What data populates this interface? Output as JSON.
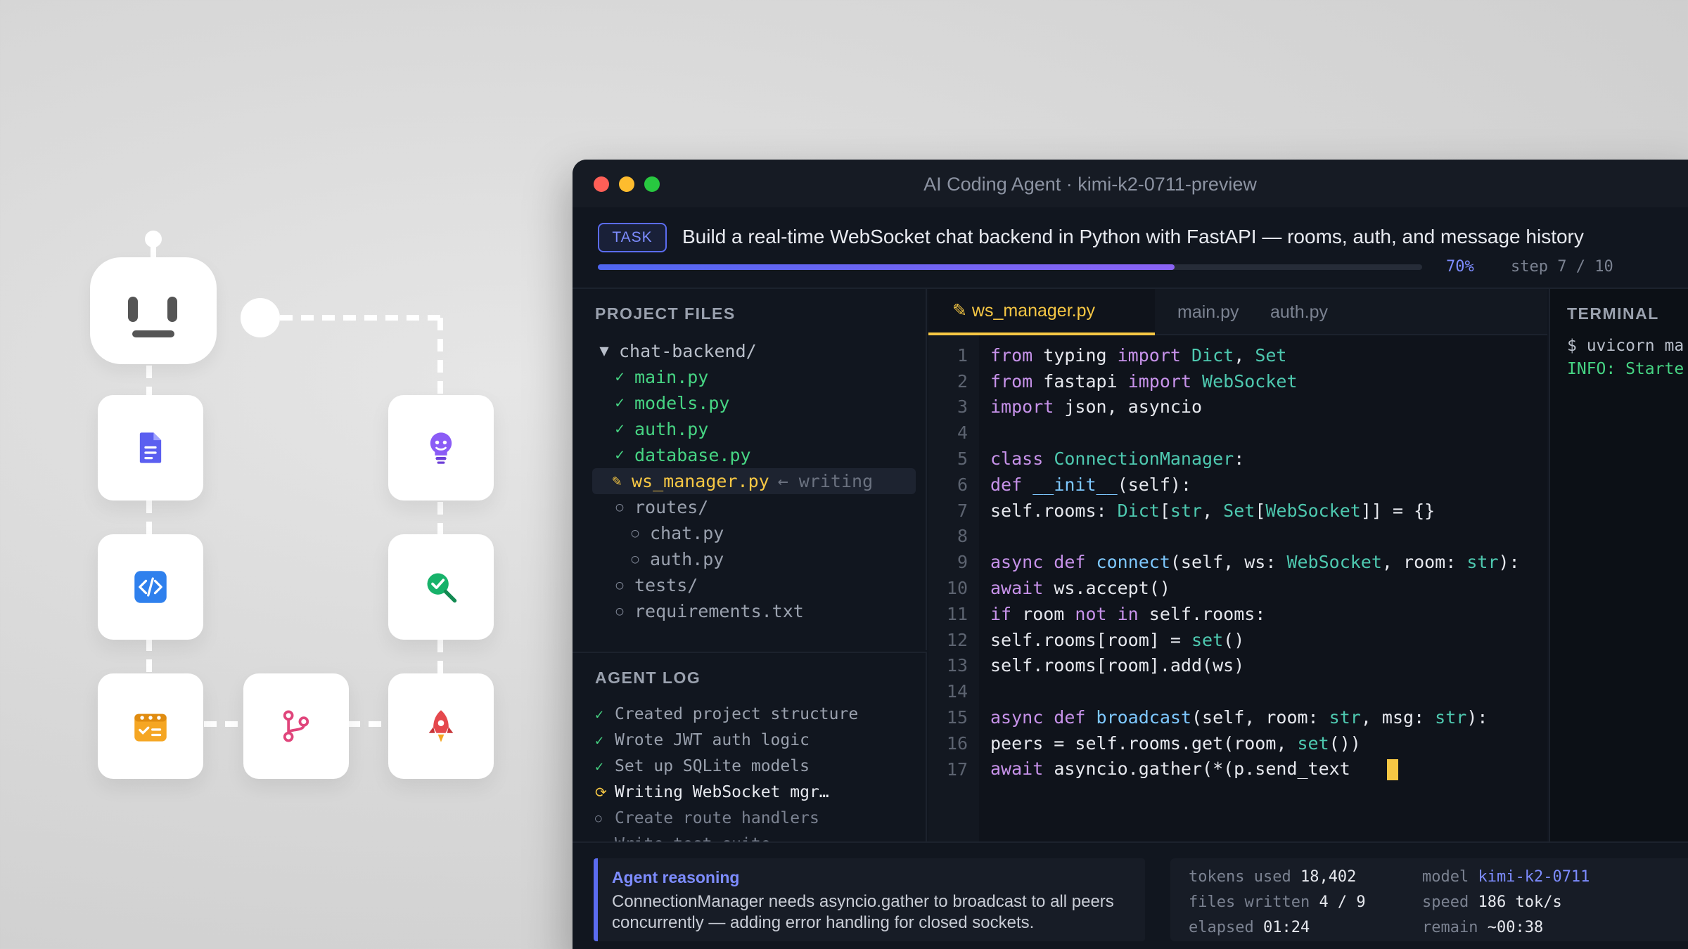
{
  "window": {
    "title": "AI Coding Agent · kimi-k2-0711-preview"
  },
  "task": {
    "badge": "TASK",
    "description": "Build a real-time WebSocket chat backend in Python with FastAPI — rooms, auth, and message history",
    "progress_percent": 70,
    "progress_label": "70%",
    "step_label": "step 7 / 10"
  },
  "files_panel": {
    "heading": "PROJECT FILES",
    "rows": [
      {
        "mark": "▼",
        "label": "chat-backend/",
        "state": "folder",
        "indent": 0,
        "note": ""
      },
      {
        "mark": "✓",
        "label": "main.py",
        "state": "done",
        "indent": 1,
        "note": ""
      },
      {
        "mark": "✓",
        "label": "models.py",
        "state": "done",
        "indent": 1,
        "note": ""
      },
      {
        "mark": "✓",
        "label": "auth.py",
        "state": "done",
        "indent": 1,
        "note": ""
      },
      {
        "mark": "✓",
        "label": "database.py",
        "state": "done",
        "indent": 1,
        "note": ""
      },
      {
        "mark": "✎",
        "label": "ws_manager.py",
        "state": "active",
        "indent": 1,
        "note": "← writing"
      },
      {
        "mark": "○",
        "label": "routes/",
        "state": "pending",
        "indent": 1,
        "note": ""
      },
      {
        "mark": "○",
        "label": "chat.py",
        "state": "pending",
        "indent": 2,
        "note": ""
      },
      {
        "mark": "○",
        "label": "auth.py",
        "state": "pending",
        "indent": 2,
        "note": ""
      },
      {
        "mark": "○",
        "label": "tests/",
        "state": "pending",
        "indent": 1,
        "note": ""
      },
      {
        "mark": "○",
        "label": "requirements.txt",
        "state": "pending",
        "indent": 1,
        "note": ""
      }
    ]
  },
  "agent_log": {
    "heading": "AGENT LOG",
    "rows": [
      {
        "mark": "✓",
        "label": "Created project structure",
        "state": "done"
      },
      {
        "mark": "✓",
        "label": "Wrote JWT auth logic",
        "state": "done"
      },
      {
        "mark": "✓",
        "label": "Set up SQLite models",
        "state": "done"
      },
      {
        "mark": "⟳",
        "label": "Writing WebSocket mgr…",
        "state": "active"
      },
      {
        "mark": "○",
        "label": "Create route handlers",
        "state": "pending"
      },
      {
        "mark": "○",
        "label": "Write test suite",
        "state": "pending"
      }
    ]
  },
  "editor": {
    "tabs": [
      {
        "label": "✎ ws_manager.py",
        "active": true
      },
      {
        "label": "main.py",
        "active": false
      },
      {
        "label": "auth.py",
        "active": false
      }
    ],
    "lines": [
      {
        "n": "1",
        "tokens": [
          [
            "kw",
            "from "
          ],
          [
            "",
            "typing "
          ],
          [
            "kw",
            "import "
          ],
          [
            "ty",
            "Dict"
          ],
          [
            "",
            ", "
          ],
          [
            "ty",
            "Set"
          ]
        ]
      },
      {
        "n": "2",
        "tokens": [
          [
            "kw",
            "from "
          ],
          [
            "",
            "fastapi "
          ],
          [
            "kw",
            "import "
          ],
          [
            "ty",
            "WebSocket"
          ]
        ]
      },
      {
        "n": "3",
        "tokens": [
          [
            "kw",
            "import "
          ],
          [
            "",
            "json, asyncio"
          ]
        ]
      },
      {
        "n": "4",
        "tokens": []
      },
      {
        "n": "5",
        "tokens": [
          [
            "kw",
            "class "
          ],
          [
            "ty",
            "ConnectionManager"
          ],
          [
            "",
            ":"
          ]
        ]
      },
      {
        "n": "6",
        "tokens": [
          [
            "kw",
            "def "
          ],
          [
            "fn",
            "__init__"
          ],
          [
            "",
            "(self):"
          ]
        ]
      },
      {
        "n": "7",
        "tokens": [
          [
            "",
            "self.rooms: "
          ],
          [
            "ty",
            "Dict"
          ],
          [
            "",
            "["
          ],
          [
            "ty",
            "str"
          ],
          [
            "",
            ", "
          ],
          [
            "ty",
            "Set"
          ],
          [
            "",
            "["
          ],
          [
            "ty",
            "WebSocket"
          ],
          [
            "",
            "]] = {}"
          ]
        ]
      },
      {
        "n": "8",
        "tokens": []
      },
      {
        "n": "9",
        "tokens": [
          [
            "kw",
            "async def "
          ],
          [
            "fn",
            "connect"
          ],
          [
            "",
            "(self, ws: "
          ],
          [
            "ty",
            "WebSocket"
          ],
          [
            "",
            ", room: "
          ],
          [
            "ty",
            "str"
          ],
          [
            "",
            "):"
          ]
        ]
      },
      {
        "n": "10",
        "tokens": [
          [
            "kw",
            "await "
          ],
          [
            "",
            "ws.accept()"
          ]
        ]
      },
      {
        "n": "11",
        "tokens": [
          [
            "kw",
            "if "
          ],
          [
            "",
            "room "
          ],
          [
            "kw",
            "not in "
          ],
          [
            "",
            "self.rooms:"
          ]
        ]
      },
      {
        "n": "12",
        "tokens": [
          [
            "",
            "self.rooms[room] = "
          ],
          [
            "ty",
            "set"
          ],
          [
            "",
            "()"
          ]
        ]
      },
      {
        "n": "13",
        "tokens": [
          [
            "",
            "self.rooms[room].add(ws)"
          ]
        ]
      },
      {
        "n": "14",
        "tokens": []
      },
      {
        "n": "15",
        "tokens": [
          [
            "kw",
            "async def "
          ],
          [
            "fn",
            "broadcast"
          ],
          [
            "",
            "(self, room: "
          ],
          [
            "ty",
            "str"
          ],
          [
            "",
            ", msg: "
          ],
          [
            "ty",
            "str"
          ],
          [
            "",
            "):"
          ]
        ]
      },
      {
        "n": "16",
        "tokens": [
          [
            "",
            "peers = self.rooms.get(room, "
          ],
          [
            "ty",
            "set"
          ],
          [
            "",
            "())"
          ]
        ]
      },
      {
        "n": "17",
        "tokens": [
          [
            "kw",
            "await "
          ],
          [
            "",
            "asyncio.gather(*(p.send_text"
          ]
        ],
        "cursor": true
      }
    ]
  },
  "terminal": {
    "heading": "TERMINAL",
    "command": "$ uvicorn ma",
    "info": "INFO: Starte"
  },
  "reasoning": {
    "title": "Agent reasoning",
    "text": "ConnectionManager needs asyncio.gather to broadcast to all peers concurrently — adding error handling for closed sockets."
  },
  "stats": {
    "tokens_label": "tokens used",
    "tokens_value": "18,402",
    "files_label": "files written",
    "files_value": "4 / 9",
    "elapsed_label": "elapsed",
    "elapsed_value": "01:24",
    "model_label": "model",
    "model_value": "kimi-k2-0711",
    "speed_label": "speed",
    "speed_value": "186 tok/s",
    "remain_label": "remain",
    "remain_value": "~00:38"
  },
  "diagram": {
    "steps": [
      {
        "icon": "document-icon"
      },
      {
        "icon": "code-icon"
      },
      {
        "icon": "checklist-calendar-icon"
      },
      {
        "icon": "branch-icon"
      },
      {
        "icon": "rocket-icon"
      },
      {
        "icon": "search-check-icon"
      },
      {
        "icon": "idea-bulb-icon"
      }
    ]
  }
}
